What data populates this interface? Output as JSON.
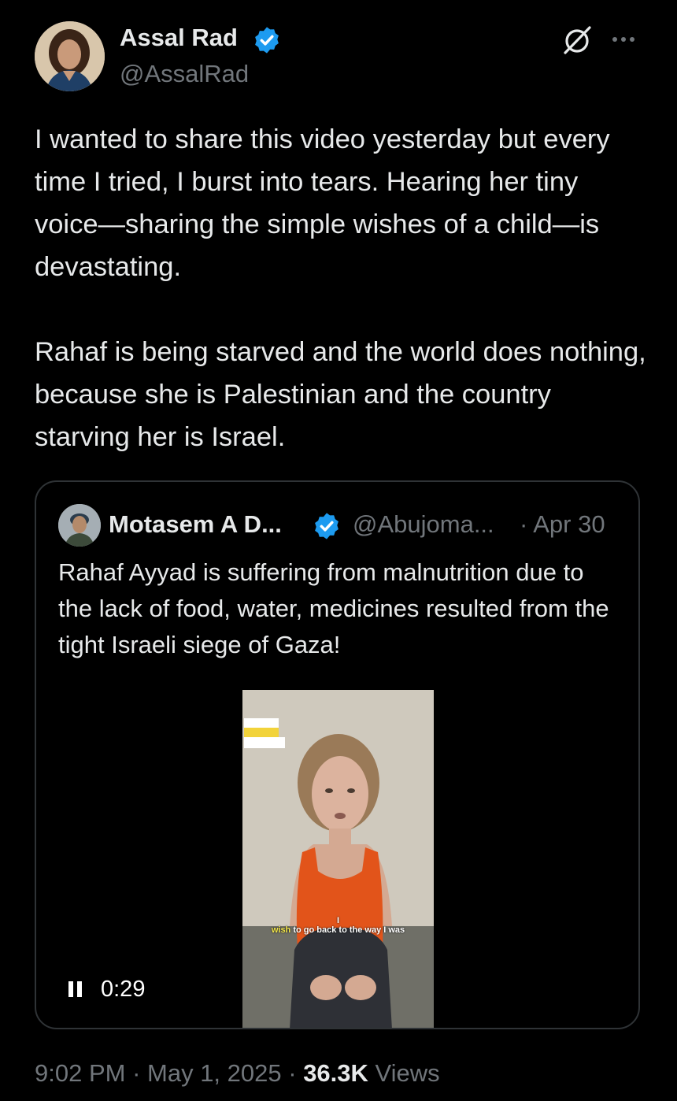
{
  "author": {
    "name": "Assal Rad",
    "handle": "@AssalRad",
    "verified": true
  },
  "header_icons": [
    "grok-icon",
    "more-icon"
  ],
  "tweet": {
    "paragraphs": [
      "I wanted to share this video yesterday but every time I tried, I burst into tears. Hearing her tiny voice—sharing the simple wishes of a child—is devastating.",
      "Rahaf is being starved and the world does nothing, because she is Palestinian and the country starving her is Israel."
    ]
  },
  "quoted": {
    "name": "Motasem A D...",
    "handle": "@Abujoma...",
    "date": "· Apr 30",
    "verified": true,
    "text": "Rahaf Ayyad is suffering from malnutrition due to the lack of food, water, medicines resulted from the tight Israeli siege of Gaza!",
    "video": {
      "caption_prefix": "I",
      "caption_highlight": "wish",
      "caption_rest": "to go back to the way I was",
      "time": "0:29",
      "state": "playing"
    }
  },
  "meta": {
    "time": "9:02 PM",
    "sep1": " · ",
    "date": "May 1, 2025",
    "sep2": " · ",
    "views_count": "36.3K",
    "views_label": " Views"
  },
  "colors": {
    "background": "#000000",
    "text": "#e7e9ea",
    "secondary": "#71767b",
    "verified_blue": "#1d9bf0",
    "border": "#2f3336"
  }
}
